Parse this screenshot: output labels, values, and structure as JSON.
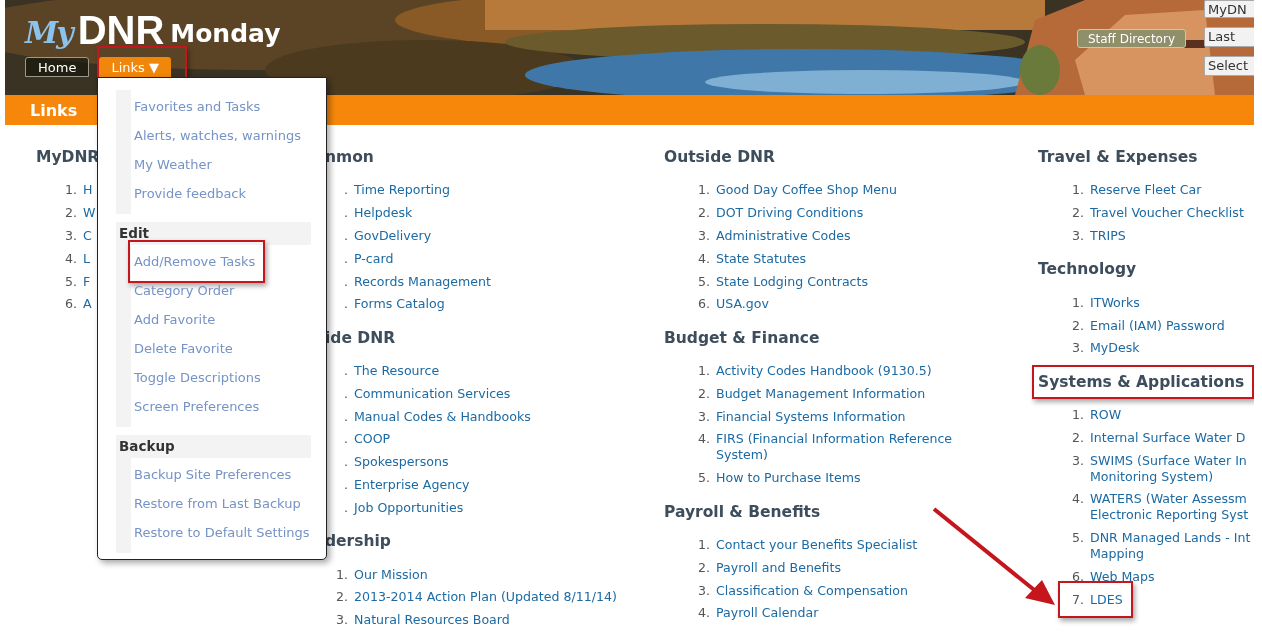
{
  "header": {
    "logo": {
      "script": "My",
      "brand": "DNR",
      "day": "Monday"
    },
    "tabs": [
      {
        "label": "Home",
        "selected": false,
        "highlighted": false
      },
      {
        "label": "Links",
        "caret": "▼",
        "selected": true,
        "highlighted": true
      }
    ],
    "staff_button": "Staff Directory",
    "fields": [
      {
        "value": "MyDN",
        "kind": "input"
      },
      {
        "value": "Last",
        "kind": "select"
      },
      {
        "value": "Select",
        "kind": "select"
      }
    ]
  },
  "page_bar": {
    "title": "Links"
  },
  "dropdown": {
    "groups": [
      {
        "items": [
          {
            "label": "Favorites and Tasks",
            "highlighted": false
          },
          {
            "label": "Alerts, watches, warnings",
            "highlighted": false
          },
          {
            "label": "My Weather",
            "highlighted": false
          },
          {
            "label": "Provide feedback",
            "highlighted": false
          }
        ]
      },
      {
        "title": "Edit",
        "items": [
          {
            "label": "Add/Remove Tasks",
            "highlighted": true
          },
          {
            "label": "Category Order",
            "highlighted": false
          },
          {
            "label": "Add Favorite",
            "highlighted": false
          },
          {
            "label": "Delete Favorite",
            "highlighted": false
          },
          {
            "label": "Toggle Descriptions",
            "highlighted": false
          },
          {
            "label": "Screen Preferences",
            "highlighted": false
          }
        ]
      },
      {
        "title": "Backup",
        "items": [
          {
            "label": "Backup Site Preferences",
            "highlighted": false
          },
          {
            "label": "Restore from Last Backup",
            "highlighted": false
          },
          {
            "label": "Restore to Default Settings",
            "highlighted": false
          }
        ]
      }
    ]
  },
  "columns": [
    {
      "sections": [
        {
          "heading": "MyDNR",
          "highlighted": false,
          "items": [
            {
              "number": "1.",
              "text": "H",
              "highlighted": false
            },
            {
              "number": "2.",
              "text": "W",
              "highlighted": false
            },
            {
              "number": "3.",
              "text": "C",
              "highlighted": false
            },
            {
              "number": "4.",
              "text": "L",
              "highlighted": false
            },
            {
              "number": "5.",
              "text": "F",
              "highlighted": false
            },
            {
              "number": "6.",
              "text": "A",
              "highlighted": false
            }
          ]
        }
      ]
    },
    {
      "sections": [
        {
          "heading": "nmon",
          "highlighted": false,
          "items": [
            {
              "number": ".",
              "text": "Time Reporting",
              "highlighted": false
            },
            {
              "number": ".",
              "text": "Helpdesk",
              "highlighted": false
            },
            {
              "number": ".",
              "text": "GovDelivery",
              "highlighted": false
            },
            {
              "number": ".",
              "text": "P-card",
              "highlighted": false
            },
            {
              "number": ".",
              "text": "Records Management",
              "highlighted": false
            },
            {
              "number": ".",
              "text": "Forms Catalog",
              "highlighted": false
            }
          ]
        },
        {
          "heading": "ide DNR",
          "highlighted": false,
          "items": [
            {
              "number": ".",
              "text": "The Resource",
              "highlighted": false
            },
            {
              "number": ".",
              "text": "Communication Services",
              "highlighted": false
            },
            {
              "number": ".",
              "text": "Manual Codes & Handbooks",
              "highlighted": false
            },
            {
              "number": ".",
              "text": "COOP",
              "highlighted": false
            },
            {
              "number": ".",
              "text": "Spokespersons",
              "highlighted": false
            },
            {
              "number": ".",
              "text": "Enterprise Agency",
              "highlighted": false
            },
            {
              "number": ".",
              "text": "Job Opportunities",
              "highlighted": false
            }
          ]
        },
        {
          "heading": "dership",
          "highlighted": false,
          "items": [
            {
              "number": "1.",
              "text": "Our Mission",
              "highlighted": false
            },
            {
              "number": "2.",
              "text": "2013-2014 Action Plan (Updated 8/11/14)",
              "highlighted": false
            },
            {
              "number": "3.",
              "text": "Natural Resources Board",
              "highlighted": false
            }
          ]
        }
      ]
    },
    {
      "sections": [
        {
          "heading": "Outside DNR",
          "highlighted": false,
          "items": [
            {
              "number": "1.",
              "text": "Good Day Coffee Shop Menu",
              "highlighted": false
            },
            {
              "number": "2.",
              "text": "DOT Driving Conditions",
              "highlighted": false
            },
            {
              "number": "3.",
              "text": "Administrative Codes",
              "highlighted": false
            },
            {
              "number": "4.",
              "text": "State Statutes",
              "highlighted": false
            },
            {
              "number": "5.",
              "text": "State Lodging Contracts",
              "highlighted": false
            },
            {
              "number": "6.",
              "text": "USA.gov",
              "highlighted": false
            }
          ]
        },
        {
          "heading": "Budget & Finance",
          "highlighted": false,
          "items": [
            {
              "number": "1.",
              "text": "Activity Codes Handbook (9130.5)",
              "highlighted": false
            },
            {
              "number": "2.",
              "text": "Budget Management Information",
              "highlighted": false
            },
            {
              "number": "3.",
              "text": "Financial Systems Information",
              "highlighted": false
            },
            {
              "number": "4.",
              "lines": [
                "FIRS (Financial Information Reference",
                "System)"
              ],
              "highlighted": false
            },
            {
              "number": "5.",
              "text": "How to Purchase Items",
              "highlighted": false
            }
          ]
        },
        {
          "heading": "Payroll & Benefits",
          "highlighted": false,
          "items": [
            {
              "number": "1.",
              "text": "Contact your Benefits Specialist",
              "highlighted": false
            },
            {
              "number": "2.",
              "text": "Payroll and Benefits",
              "highlighted": false
            },
            {
              "number": "3.",
              "text": "Classification & Compensation",
              "highlighted": false
            },
            {
              "number": "4.",
              "text": "Payroll Calendar",
              "highlighted": false
            }
          ]
        }
      ]
    },
    {
      "sections": [
        {
          "heading": "Travel & Expenses",
          "highlighted": false,
          "items": [
            {
              "number": "1.",
              "text": "Reserve Fleet Car",
              "highlighted": false
            },
            {
              "number": "2.",
              "text": "Travel Voucher Checklist",
              "highlighted": false
            },
            {
              "number": "3.",
              "text": "TRIPS",
              "highlighted": false
            }
          ]
        },
        {
          "heading": "Technology",
          "highlighted": false,
          "items": [
            {
              "number": "1.",
              "text": "ITWorks",
              "highlighted": false
            },
            {
              "number": "2.",
              "text": "Email (IAM) Password",
              "highlighted": false
            },
            {
              "number": "3.",
              "text": "MyDesk",
              "highlighted": false
            }
          ]
        },
        {
          "heading": "Systems & Applications",
          "highlighted": true,
          "items": [
            {
              "number": "1.",
              "text": "ROW",
              "highlighted": false
            },
            {
              "number": "2.",
              "text": "Internal Surface Water D",
              "highlighted": false
            },
            {
              "number": "3.",
              "lines": [
                "SWIMS (Surface Water In",
                "Monitoring System)"
              ],
              "highlighted": false
            },
            {
              "number": "4.",
              "lines": [
                "WATERS (Water Assessm",
                "Electronic Reporting Syst"
              ],
              "highlighted": false
            },
            {
              "number": "5.",
              "lines": [
                "DNR Managed Lands - Int",
                "Mapping"
              ],
              "highlighted": false
            },
            {
              "number": "6.",
              "text": "Web Maps",
              "highlighted": false
            },
            {
              "number": "7.",
              "text": "LDES",
              "highlighted": true
            }
          ]
        }
      ]
    }
  ]
}
